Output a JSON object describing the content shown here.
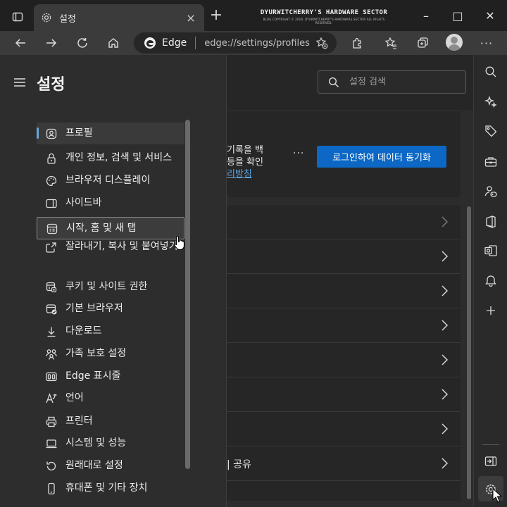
{
  "window": {
    "tab_title": "설정",
    "tab_close": "×",
    "new_tab": "+",
    "watermark_title": "DYURWITCHERRY'S HARDWARE SECTOR",
    "watermark_sub": "BLOG COPYRIGHT © 2018. DYURWITCHERRY'S HARDWARE SECTOR ALL RIGHTS RESERVED.",
    "controls": {
      "minimize": "–",
      "maximize": "□",
      "close": "✕"
    }
  },
  "toolbar": {
    "site_name": "Edge",
    "url": "edge://settings/profiles",
    "icons": [
      "back-icon",
      "forward-icon",
      "refresh-icon",
      "home-icon",
      "add-favorite-icon",
      "extensions-icon",
      "favorites-icon",
      "collections-icon",
      "profile-avatar",
      "more-icon"
    ],
    "more_label": "···"
  },
  "settings": {
    "title": "설정",
    "search_placeholder": "설정 검색",
    "nav_items": [
      {
        "label": "프로필",
        "icon": "profile-icon"
      },
      {
        "label": "개인 정보, 검색 및 서비스",
        "icon": "lock-icon"
      },
      {
        "label": "브라우저 디스플레이",
        "icon": "palette-icon"
      },
      {
        "label": "사이드바",
        "icon": "sidebar-icon"
      },
      {
        "label": "시작, 홈 및 새 탭",
        "icon": "start-page-icon"
      },
      {
        "label": "잘라내기, 복사 및 붙여넣기",
        "icon": "share-icon"
      },
      {
        "label": "쿠키 및 사이트 권한",
        "icon": "cookie-icon"
      },
      {
        "label": "기본 브라우저",
        "icon": "default-browser-icon"
      },
      {
        "label": "다운로드",
        "icon": "download-icon"
      },
      {
        "label": "가족 보호 설정",
        "icon": "family-icon"
      },
      {
        "label": "Edge 표시줄",
        "icon": "edge-bar-icon"
      },
      {
        "label": "언어",
        "icon": "language-icon"
      },
      {
        "label": "프린터",
        "icon": "printer-icon"
      },
      {
        "label": "시스템 및 성능",
        "icon": "system-icon"
      },
      {
        "label": "원래대로 설정",
        "icon": "reset-icon"
      },
      {
        "label": "휴대폰 및 기타 장치",
        "icon": "phone-icon"
      }
    ],
    "active_index": 0,
    "hover_index": 4
  },
  "profile_card": {
    "text_line1": "기록을 백",
    "text_line2": "등을 확인",
    "link_text": "리방침",
    "more_label": "···",
    "sync_button": "로그인하여 데이터 동기화"
  },
  "profile_rows": [
    {
      "label": ""
    },
    {
      "label": ""
    },
    {
      "label": ""
    },
    {
      "label": ""
    },
    {
      "label": ""
    },
    {
      "label": ""
    },
    {
      "label": ""
    },
    {
      "label": "| 공유"
    }
  ],
  "right_sidebar": {
    "icons": [
      "search-icon",
      "discover-icon",
      "shopping-icon",
      "tools-icon",
      "games-icon",
      "office-icon",
      "outlook-icon",
      "notification-icon",
      "add-icon",
      "hide-sidebar-icon",
      "settings-icon"
    ]
  }
}
